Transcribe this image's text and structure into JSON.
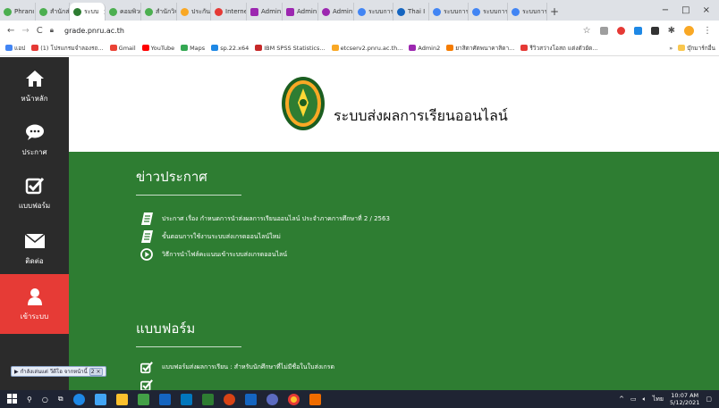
{
  "browser": {
    "tabs": [
      {
        "label": "Phranı",
        "icon": "circle-icon",
        "color": "#4caf50",
        "active": false
      },
      {
        "label": "สำนักส่ง",
        "icon": "circle-icon",
        "color": "#4caf50",
        "active": false
      },
      {
        "label": "ระบบ",
        "icon": "circle-icon",
        "color": "#2e7d32",
        "active": true
      },
      {
        "label": "คอมพิวเ",
        "icon": "circle-icon",
        "color": "#4caf50",
        "active": false
      },
      {
        "label": "สำนักวิจ",
        "icon": "circle-icon",
        "color": "#4caf50",
        "active": false
      },
      {
        "label": "ประกันฯ",
        "icon": "triangle-icon",
        "color": "#f9a825",
        "active": false
      },
      {
        "label": "Interne",
        "icon": "circle-icon",
        "color": "#e53935",
        "active": false
      },
      {
        "label": "Admin",
        "icon": "square-icon",
        "color": "#9c27b0",
        "active": false
      },
      {
        "label": "Admin",
        "icon": "square-icon",
        "color": "#9c27b0",
        "active": false
      },
      {
        "label": "Admin",
        "icon": "circle-icon",
        "color": "#9c27b0",
        "active": false
      },
      {
        "label": "ระบบการ",
        "icon": "g-icon",
        "color": "#4285f4",
        "active": false
      },
      {
        "label": "Thai I",
        "icon": "circle-icon",
        "color": "#1565c0",
        "active": false
      },
      {
        "label": "ระบบการ",
        "icon": "g-icon",
        "color": "#4285f4",
        "active": false
      },
      {
        "label": "ระบบการ",
        "icon": "g-icon",
        "color": "#4285f4",
        "active": false
      },
      {
        "label": "ระบบการ",
        "icon": "g-icon",
        "color": "#4285f4",
        "active": false
      }
    ],
    "new_tab": "+",
    "tab_close": "×",
    "window_controls": {
      "minimize": "−",
      "maximize": "□",
      "close": "×"
    },
    "url": "grade.pnru.ac.th",
    "bookmarks": [
      {
        "label": "แอป",
        "color": "#4285f4"
      },
      {
        "label": "(1) โปรแกรมจำลองรถ...",
        "color": "#e53935"
      },
      {
        "label": "Gmail",
        "color": "#ea4335"
      },
      {
        "label": "YouTube",
        "color": "#ff0000"
      },
      {
        "label": "Maps",
        "color": "#34a853"
      },
      {
        "label": "sp.22.x64",
        "color": "#1e88e5"
      },
      {
        "label": "IBM SPSS Statistics...",
        "color": "#c62828"
      },
      {
        "label": "etcserv2.pnru.ac.th...",
        "color": "#f9a825"
      },
      {
        "label": "Admin2",
        "color": "#9c27b0"
      },
      {
        "label": "ยาสิตาศัตพนาคาสิดา...",
        "color": "#f57c00"
      },
      {
        "label": "รีวิวสว่างโอสถ แต่งตัวยัด...",
        "color": "#e53935"
      }
    ],
    "bookmarks_more": "»",
    "other_bookmarks": "บุ๊กมาร์กอื่น"
  },
  "sidebar": {
    "items": [
      {
        "label": "หน้าหลัก",
        "icon": "home-icon"
      },
      {
        "label": "ประกาศ",
        "icon": "chat-bubble-icon"
      },
      {
        "label": "แบบฟอร์ม",
        "icon": "checkbox-icon"
      },
      {
        "label": "ติดต่อ",
        "icon": "envelope-icon"
      },
      {
        "label": "เข้าระบบ",
        "icon": "user-icon",
        "active": true
      }
    ]
  },
  "header": {
    "title": "ระบบส่งผลการเรียนออนไลน์"
  },
  "news": {
    "title": "ข่าวประกาศ",
    "items": [
      {
        "text": "ประกาศ เรื่อง กำหนดการนำส่งผลการเรียนออนไลน์ ประจำภาคการศึกษาที่ 2 / 2563",
        "icon": "document-icon"
      },
      {
        "text": "ขั้นตอนการใช้งานระบบส่งเกรดออนไลน์ใหม่",
        "icon": "document-icon"
      },
      {
        "text": "วิธีการนำไฟล์คะแนนเข้าระบบส่งเกรดออนไลน์",
        "icon": "play-circle-icon"
      }
    ]
  },
  "forms": {
    "title": "แบบฟอร์ม",
    "items": [
      {
        "text": "แบบฟอร์มส่งผลการเรียน : สำหรับนักศึกษาที่ไม่มีชื่อในใบส่งเกรด",
        "icon": "checkbox-icon"
      },
      {
        "text": "",
        "icon": "checkbox-icon"
      }
    ]
  },
  "media_overlay": {
    "text": "กำลังเล่นแต่ วีดีโอ จากหน้านี้",
    "controls": "2 ×"
  },
  "taskbar": {
    "time": "10:07 AM",
    "date": "5/12/2021",
    "language": "ไทย"
  },
  "colors": {
    "sidebar_bg": "#2b2b2b",
    "sidebar_active": "#e63b36",
    "content_green": "#2e7d32"
  }
}
